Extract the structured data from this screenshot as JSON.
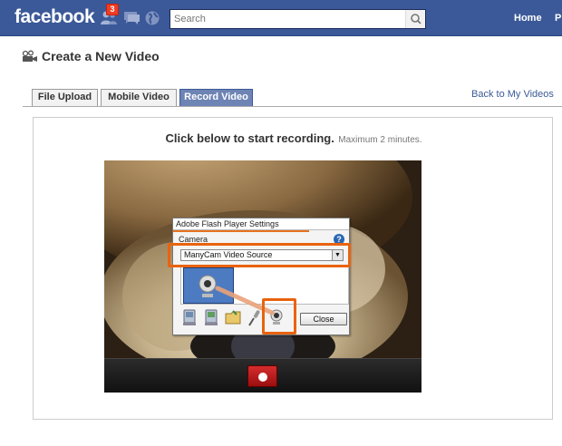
{
  "topbar": {
    "logo": "facebook",
    "friend_requests_count": "3",
    "search_placeholder": "Search",
    "nav": [
      "Home",
      "P"
    ]
  },
  "page": {
    "title": "Create a New Video"
  },
  "tabs": [
    {
      "label": "File Upload",
      "active": false
    },
    {
      "label": "Mobile Video",
      "active": false
    },
    {
      "label": "Record Video",
      "active": true
    }
  ],
  "back_link": "Back to My Videos",
  "recorder": {
    "instruction": "Click below to start recording.",
    "limit": "Maximum 2 minutes."
  },
  "flash_settings": {
    "title": "Adobe Flash Player Settings",
    "section": "Camera",
    "help": "?",
    "camera_source": "ManyCam Video Source",
    "close_label": "Close",
    "tab_icons": [
      "privacy-icon",
      "storage-icon",
      "microphone-icon",
      "camera-setting-icon",
      "webcam-icon"
    ]
  },
  "colors": {
    "brand": "#3b5998",
    "highlight": "#e9630f",
    "record": "#c21818"
  }
}
